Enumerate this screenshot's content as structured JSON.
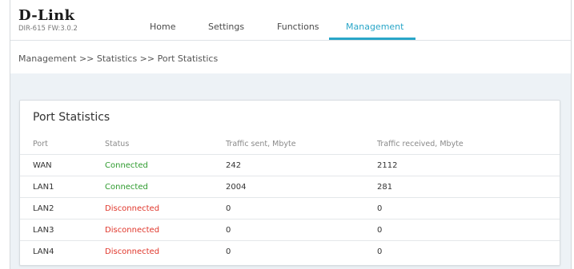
{
  "header": {
    "logo": "D-Link",
    "firmware": "DIR-615 FW:3.0.2",
    "nav": [
      {
        "label": "Home"
      },
      {
        "label": "Settings"
      },
      {
        "label": "Functions"
      },
      {
        "label": "Management",
        "active": true
      }
    ],
    "accent_color": "#29a6c8"
  },
  "breadcrumb": "Management >> Statistics >> Port Statistics",
  "card": {
    "title": "Port Statistics",
    "columns": [
      "Port",
      "Status",
      "Traffic sent, Mbyte",
      "Traffic received, Mbyte"
    ],
    "rows": [
      {
        "port": "WAN",
        "status": "Connected",
        "sent": "242",
        "received": "2112"
      },
      {
        "port": "LAN1",
        "status": "Connected",
        "sent": "2004",
        "received": "281"
      },
      {
        "port": "LAN2",
        "status": "Disconnected",
        "sent": "0",
        "received": "0"
      },
      {
        "port": "LAN3",
        "status": "Disconnected",
        "sent": "0",
        "received": "0"
      },
      {
        "port": "LAN4",
        "status": "Disconnected",
        "sent": "0",
        "received": "0"
      }
    ],
    "status_colors": {
      "Connected": "#2e9b2e",
      "Disconnected": "#e0362b"
    }
  }
}
